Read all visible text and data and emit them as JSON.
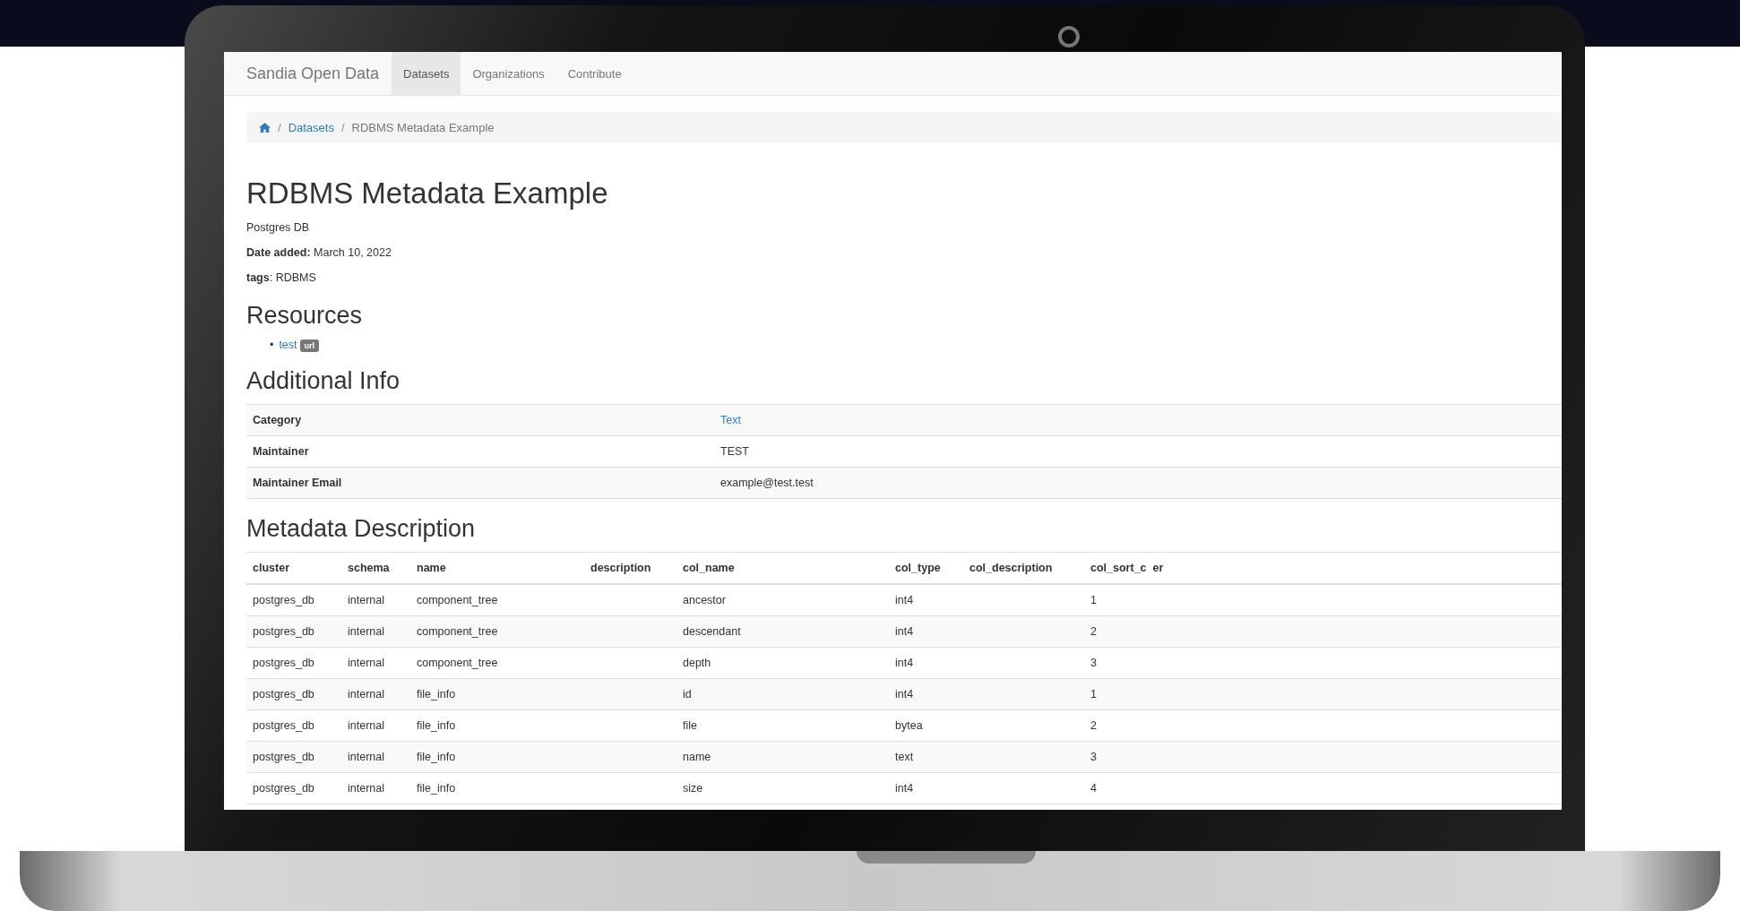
{
  "nav": {
    "brand": "Sandia Open Data",
    "items": [
      {
        "label": "Datasets",
        "selected": true
      },
      {
        "label": "Organizations",
        "selected": false
      },
      {
        "label": "Contribute",
        "selected": false
      }
    ]
  },
  "breadcrumb_separator": "/",
  "breadcrumb": [
    {
      "kind": "home"
    },
    {
      "kind": "link",
      "label": "Datasets"
    },
    {
      "kind": "current",
      "label": "RDBMS Metadata Example"
    }
  ],
  "title": "RDBMS Metadata Example",
  "subtitle": "Postgres DB",
  "date_added": "**Date added:** March 10, 2022",
  "tags": "**tags**: RDBMS",
  "resources": {
    "heading": "Resources",
    "items": [
      {
        "marker": "•",
        "label": "test",
        "format": "url"
      }
    ]
  },
  "additional_info": {
    "heading": "Additional Info",
    "rows": [
      {
        "key": "Category",
        "value": "Text",
        "kind": "link"
      },
      {
        "key": "Maintainer",
        "value": "TEST",
        "kind": "text"
      },
      {
        "key": "Maintainer Email",
        "value": "example@test.test",
        "kind": "text"
      }
    ]
  },
  "metadata": {
    "heading": "Metadata Description",
    "columns": [
      "cluster",
      "schema",
      "name",
      "description",
      "col_name",
      "col_type",
      "col_description",
      "col_sort_c  er"
    ],
    "rows": [
      [
        "postgres_db",
        "internal",
        "component_tree",
        "",
        "ancestor",
        "int4",
        "",
        "1"
      ],
      [
        "postgres_db",
        "internal",
        "component_tree",
        "",
        "descendant",
        "int4",
        "",
        "2"
      ],
      [
        "postgres_db",
        "internal",
        "component_tree",
        "",
        "depth",
        "int4",
        "",
        "3"
      ],
      [
        "postgres_db",
        "internal",
        "file_info",
        "",
        "id",
        "int4",
        "",
        "1"
      ],
      [
        "postgres_db",
        "internal",
        "file_info",
        "",
        "file",
        "bytea",
        "",
        "2"
      ],
      [
        "postgres_db",
        "internal",
        "file_info",
        "",
        "name",
        "text",
        "",
        "3"
      ],
      [
        "postgres_db",
        "internal",
        "file_info",
        "",
        "size",
        "int4",
        "",
        "4"
      ]
    ]
  }
}
